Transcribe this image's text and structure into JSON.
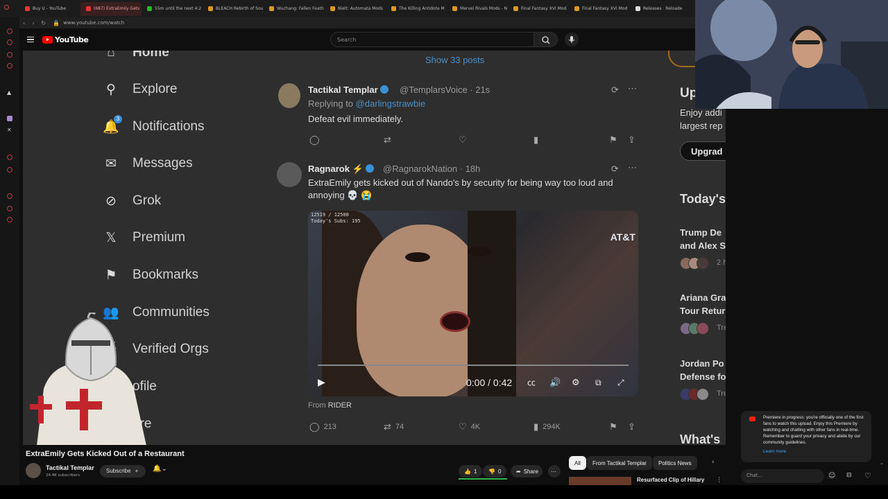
{
  "browser": {
    "tabs": [
      {
        "label": "Buy U - YouTube",
        "color": "#e33"
      },
      {
        "label": "(687) ExtraEmily Gets",
        "color": "#e33",
        "active": true
      },
      {
        "label": "55m until the next 4:2",
        "color": "#2b2"
      },
      {
        "label": "BLEACH Rebirth of Sou",
        "color": "#d92"
      },
      {
        "label": "Wuchang: Fallen Feath",
        "color": "#d92"
      },
      {
        "label": "Nielt: Automata Mods",
        "color": "#d92"
      },
      {
        "label": "The Killing Antidote M",
        "color": "#d92"
      },
      {
        "label": "Marvel Rivals Mods - N",
        "color": "#d92"
      },
      {
        "label": "Final Fantasy XVI Mod",
        "color": "#d92"
      },
      {
        "label": "Final Fantasy XVI Mod",
        "color": "#d92"
      },
      {
        "label": "Releases · Reloade",
        "color": "#ddd"
      }
    ],
    "url": "www.youtube.com/watch"
  },
  "youtube": {
    "logo": "YouTube",
    "search_placeholder": "Search"
  },
  "xnav": [
    {
      "label": "Home",
      "icon": "home-icon",
      "glyph": "⌂"
    },
    {
      "label": "Explore",
      "icon": "search-icon",
      "glyph": "⚲"
    },
    {
      "label": "Notifications",
      "icon": "bell-icon",
      "glyph": "🔔"
    },
    {
      "label": "Messages",
      "icon": "mail-icon",
      "glyph": "✉"
    },
    {
      "label": "Grok",
      "icon": "grok-icon",
      "glyph": "⊘"
    },
    {
      "label": "Premium",
      "icon": "x-logo-icon",
      "glyph": "𝕏"
    },
    {
      "label": "Bookmarks",
      "icon": "bookmark-icon",
      "glyph": "⚑"
    },
    {
      "label": "Communities",
      "icon": "people-icon",
      "glyph": "👥"
    },
    {
      "label": "Verified Orgs",
      "icon": "lightning-icon",
      "glyph": "⚡"
    },
    {
      "label": "ofile",
      "icon": "profile-icon",
      "glyph": "◯"
    },
    {
      "label": "ore",
      "icon": "more-icon",
      "glyph": "⋯"
    }
  ],
  "notif_count": "3",
  "feed": {
    "show_posts": "Show 33 posts",
    "tweet1": {
      "name": "Tactikal Templar",
      "handle": "@TemplarsVoice · 21s",
      "replying_prefix": "Replying to ",
      "replying_to": "@darlingstrawbie",
      "text": "Defeat evil immediately."
    },
    "tweet2": {
      "name": "Ragnarok",
      "handle": "@RagnarokNation · 18h",
      "text": "ExtraEmily gets kicked out of Nando's by security for being way too loud and annoying 💀 😭",
      "video_time": "0:00 / 0:42",
      "video_brand": "AT&T",
      "overlay_line1": "12519 / 12500",
      "overlay_line2": "Today's Subs: 195",
      "from_prefix": "From ",
      "from_source": "RIDER",
      "replies": "213",
      "reposts": "74",
      "likes": "4K",
      "views": "294K"
    }
  },
  "rightcol": {
    "upsell_title": "Up",
    "upsell_line1": "Enjoy addi",
    "upsell_line2": "largest rep",
    "upgrade": "Upgrad",
    "trending_title": "Today's",
    "news": [
      {
        "line1": "Trump De",
        "line2": "and Alex S",
        "meta": "2 h"
      },
      {
        "line1": "Ariana Gra",
        "line2": "Tour Retur",
        "meta": "Tre"
      },
      {
        "line1": "Jordan Po",
        "line2": "Defense fo",
        "meta": "Tre"
      }
    ],
    "whats": "What's"
  },
  "video_info": {
    "title": "ExtraEmily Gets Kicked Out of a Restaurant",
    "channel": "Tactikal Templar",
    "subs": "24.4K subscribers",
    "subscribe": "Subscribe",
    "likes": "1",
    "dislikes": "0",
    "share": "Share"
  },
  "chips": [
    "All",
    "From Tactikal Templar",
    "Politics News"
  ],
  "rec_title": "Resurfaced Clip of Hillary",
  "chat": {
    "premiere_text": "Premiere in progress: you're officially one of the first fans to watch this upload. Enjoy this Premiere by watching and chatting with other fans in real-time. Remember to guard your privacy and abide by our community guidelines.",
    "learn_more": "Learn more",
    "placeholder": "Chat..."
  }
}
